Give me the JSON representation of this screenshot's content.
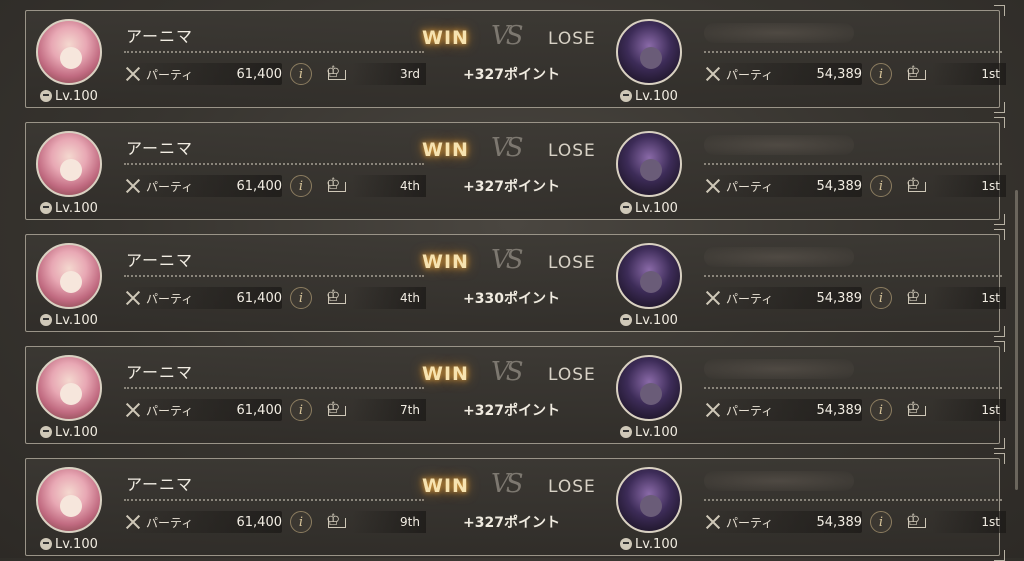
{
  "labels": {
    "win": "WIN",
    "vs": "VS",
    "lose": "LOSE",
    "party": "パーティ",
    "info": "i"
  },
  "battles": [
    {
      "left": {
        "name": "アーニマ",
        "level": "Lv.100",
        "party_power": "61,400",
        "rank": "3rd"
      },
      "points": "+327ポイント",
      "right": {
        "name": "",
        "level": "Lv.100",
        "party_power": "54,389",
        "rank": "1st"
      }
    },
    {
      "left": {
        "name": "アーニマ",
        "level": "Lv.100",
        "party_power": "61,400",
        "rank": "4th"
      },
      "points": "+327ポイント",
      "right": {
        "name": "",
        "level": "Lv.100",
        "party_power": "54,389",
        "rank": "1st"
      }
    },
    {
      "left": {
        "name": "アーニマ",
        "level": "Lv.100",
        "party_power": "61,400",
        "rank": "4th"
      },
      "points": "+330ポイント",
      "right": {
        "name": "",
        "level": "Lv.100",
        "party_power": "54,389",
        "rank": "1st"
      }
    },
    {
      "left": {
        "name": "アーニマ",
        "level": "Lv.100",
        "party_power": "61,400",
        "rank": "7th"
      },
      "points": "+327ポイント",
      "right": {
        "name": "",
        "level": "Lv.100",
        "party_power": "54,389",
        "rank": "1st"
      }
    },
    {
      "left": {
        "name": "アーニマ",
        "level": "Lv.100",
        "party_power": "61,400",
        "rank": "9th"
      },
      "points": "+327ポイント",
      "right": {
        "name": "",
        "level": "Lv.100",
        "party_power": "54,389",
        "rank": "1st"
      }
    }
  ],
  "colors": {
    "background": "#37342f",
    "win_glow": "#e6a640",
    "border": "#9a9488"
  }
}
